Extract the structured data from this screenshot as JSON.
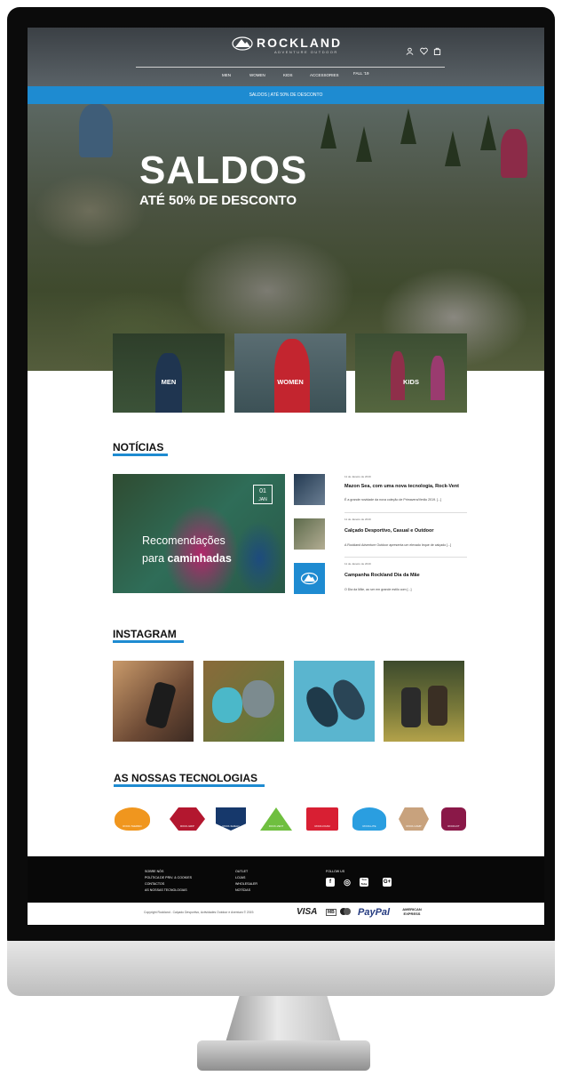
{
  "brand": {
    "name": "ROCKLAND",
    "tagline": "ADVENTURE OUTDOOR"
  },
  "header_icons": [
    "user-icon",
    "heart-icon",
    "bag-icon"
  ],
  "nav": [
    "MEN",
    "WOMEN",
    "KIDS",
    "ACCESSORIES",
    "FALL '19"
  ],
  "promo": "SALDOS | ATÉ 50% DE DESCONTO",
  "hero": {
    "title": "SALDOS",
    "subtitle": "ATÉ 50% DE DESCONTO"
  },
  "categories": [
    "MEN",
    "WOMEN",
    "KIDS"
  ],
  "news": {
    "section_title": "NOTÍCIAS",
    "featured": {
      "day": "01",
      "month": "JAN",
      "line1": "Recomendações",
      "line2_pre": "para",
      "line2_bold": "caminhadas"
    },
    "items": [
      {
        "date": "11 de Janeiro de 2019",
        "title": "Mazon Sea, com uma nova tecnologia, Rock-Vent",
        "text": "É a grande novidade da nova coleção de Primavera/Verão 2019. [...]"
      },
      {
        "date": "11 de Janeiro de 2019",
        "title": "Calçado Desportivo, Casual e Outdoor",
        "text": "A Rockland Adventure Outdoor apresenta um elevado leque de calçado [...]"
      },
      {
        "date": "11 de Janeiro de 2019",
        "title": "Campanha Rockland Dia da Mãe",
        "text": "O Dia da Mãe, ao ser em grande estilo com [...]"
      }
    ]
  },
  "instagram": {
    "section_title": "INSTAGRAM"
  },
  "technologies": {
    "section_title": "AS NOSSAS TECNOLOGIAS",
    "items": [
      {
        "name": "ROCK-THERMO",
        "color": "#f0961e"
      },
      {
        "name": "ROCK-GRIP",
        "color": "#b3172f"
      },
      {
        "name": "ROCK-SHIELD",
        "color": "#16386b"
      },
      {
        "name": "ROCK-VENT",
        "color": "#6fbf3f"
      },
      {
        "name": "ROCK-FOAM",
        "color": "#d81f33"
      },
      {
        "name": "ROCK-LITE",
        "color": "#2a9ee0"
      },
      {
        "name": "ROCK-CAMP",
        "color": "#c8a27d"
      },
      {
        "name": "ROCK-FIT",
        "color": "#8a1848"
      }
    ]
  },
  "footer": {
    "col1": [
      "SOBRE NÓS",
      "POLÍTICA DE PRIV. & COOKIES",
      "CONTACTOS",
      "AS NOSSAS TECNOLOGIAS"
    ],
    "col2": [
      "OUTLET",
      "LOJAS",
      "WHOLESALER",
      "NOTÍCIAS"
    ],
    "follow_label": "FOLLOW US",
    "social": [
      "f",
      "◎",
      "You Tube",
      "G+"
    ],
    "copyright": "Copyright Rockland - Calçado Desportivo, Actividades Outdoor e Aventura © 2019.",
    "payments": [
      "VISA",
      "MB",
      "PayPal",
      "AMERICAN EXPRESS"
    ]
  },
  "colors": {
    "accent": "#1e8bd1",
    "footer_bg": "#080808"
  }
}
